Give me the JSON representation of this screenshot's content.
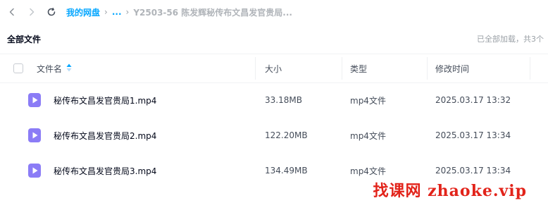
{
  "nav": {
    "back_icon": "chevron-left-icon",
    "forward_icon": "chevron-right-icon",
    "refresh_icon": "refresh-icon"
  },
  "breadcrumb": {
    "root": "我的网盘",
    "ellipsis": "...",
    "current": "Y2503-56 陈发辉秘传布文昌发官贵局..."
  },
  "header": {
    "title": "全部文件",
    "status": "已全部加载，共3个"
  },
  "table": {
    "columns": {
      "name": "文件名",
      "size": "大小",
      "type": "类型",
      "modified": "修改时间"
    },
    "rows": [
      {
        "name": "秘传布文昌发官贵局1.mp4",
        "size": "33.18MB",
        "type": "mp4文件",
        "modified": "2025.03.17 13:32"
      },
      {
        "name": "秘传布文昌发官贵局2.mp4",
        "size": "122.20MB",
        "type": "mp4文件",
        "modified": "2025.03.17 13:34"
      },
      {
        "name": "秘传布文昌发官贵局3.mp4",
        "size": "134.49MB",
        "type": "mp4文件",
        "modified": "2025.03.17 13:34"
      }
    ]
  },
  "colors": {
    "accent": "#06a7ff",
    "video_icon": "#8b7cf6",
    "watermark": "#e2231a"
  },
  "watermark": {
    "text": "找课网 zhaoke.vip"
  }
}
